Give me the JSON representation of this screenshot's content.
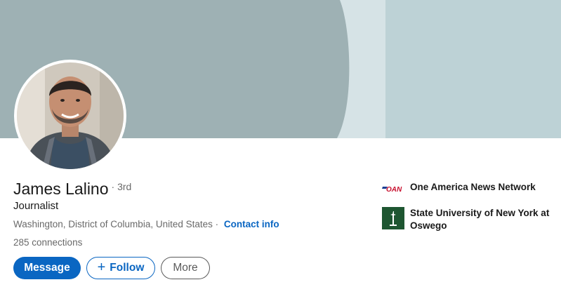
{
  "profile": {
    "name": "James Lalino",
    "degree": "· 3rd",
    "headline": "Journalist",
    "location": "Washington, District of Columbia, United States",
    "separator": "·",
    "contact_info_label": "Contact info",
    "connections": "285 connections"
  },
  "actions": {
    "message_label": "Message",
    "follow_icon": "+",
    "follow_label": "Follow",
    "more_label": "More"
  },
  "organizations": [
    {
      "name": "One America News Network",
      "logo_icon": "oan-logo-icon",
      "logo_text": "OAN"
    },
    {
      "name": "State University of New York at Oswego",
      "logo_icon": "suny-oswego-logo-icon"
    }
  ],
  "colors": {
    "accent": "#0a66c2",
    "banner_left": "#9eb1b4",
    "banner_mid": "#d6e3e6",
    "banner_right": "#bdd2d6",
    "oan_red": "#c8102e",
    "oswego_green": "#1e5631"
  }
}
